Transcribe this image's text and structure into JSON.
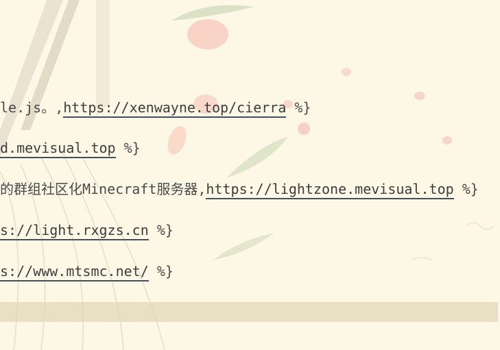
{
  "lines": [
    {
      "prefix": "le.js。,",
      "link": "https://xenwayne.top/cierra",
      "suffix": " %}"
    },
    {
      "prefix": "",
      "link": "d.mevisual.top",
      "suffix": " %}"
    },
    {
      "prefix": "的群组社区化Minecraft服务器,",
      "link": "https://lightzone.mevisual.top",
      "suffix": " %}"
    },
    {
      "prefix": "",
      "link": "s://light.rxgzs.cn",
      "suffix": " %}"
    },
    {
      "prefix": "",
      "link": "s://www.mtsmc.net/",
      "suffix": " %}"
    }
  ],
  "colors": {
    "background": "#fdf8e6",
    "text": "#4a4a4a",
    "link_underline": "#3f4f5c",
    "current_line_highlight": "#e1d7b6"
  }
}
